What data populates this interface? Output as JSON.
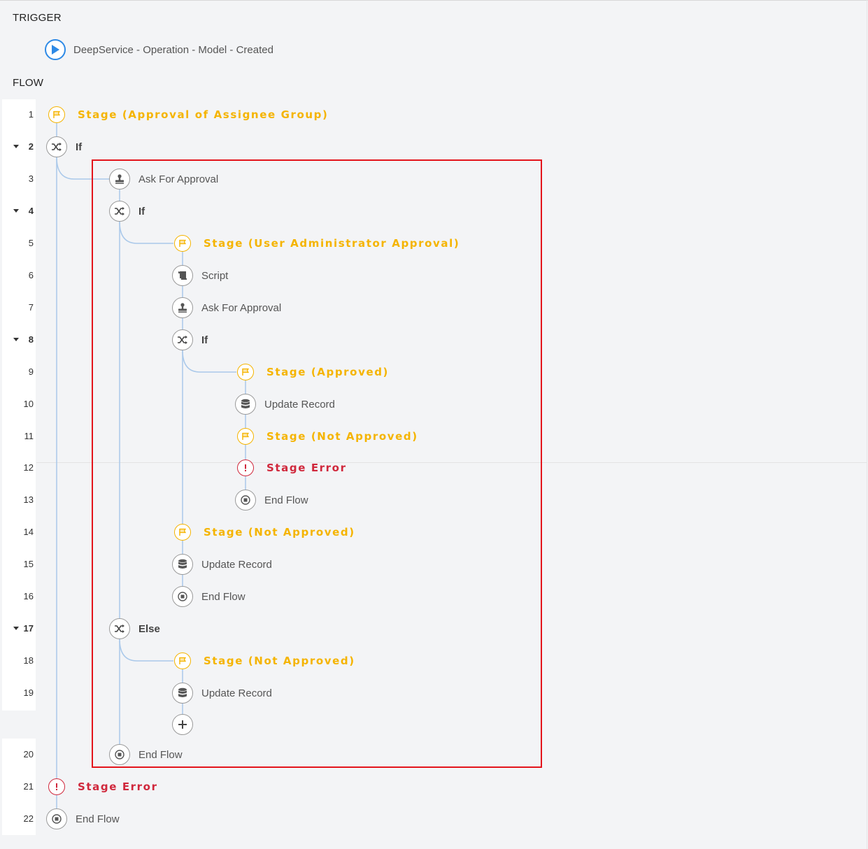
{
  "trigger": {
    "section_label": "TRIGGER",
    "name": "DeepService - Operation - Model - Created",
    "icon": "play-icon",
    "icon_color": "#2e8ae6"
  },
  "flow": {
    "section_label": "FLOW",
    "colors": {
      "stage": "#f5b400",
      "error": "#d0283c",
      "connector": "#a9c8ea"
    },
    "steps": [
      {
        "line": "1",
        "label": "Stage (Approval of Assignee Group)",
        "kind": "stage",
        "icon": "stage-flag-icon"
      },
      {
        "line": "2",
        "label": "If",
        "kind": "logic",
        "icon": "shuffle-icon",
        "collapsible": true
      },
      {
        "line": "3",
        "label": "Ask For Approval",
        "kind": "action",
        "icon": "approval-stamp-icon"
      },
      {
        "line": "4",
        "label": "If",
        "kind": "logic",
        "icon": "shuffle-icon",
        "collapsible": true
      },
      {
        "line": "5",
        "label": "Stage (User Administrator Approval)",
        "kind": "stage",
        "icon": "stage-flag-icon"
      },
      {
        "line": "6",
        "label": "Script",
        "kind": "action",
        "icon": "script-icon"
      },
      {
        "line": "7",
        "label": "Ask For Approval",
        "kind": "action",
        "icon": "approval-stamp-icon"
      },
      {
        "line": "8",
        "label": "If",
        "kind": "logic",
        "icon": "shuffle-icon",
        "collapsible": true
      },
      {
        "line": "9",
        "label": "Stage (Approved)",
        "kind": "stage",
        "icon": "stage-flag-icon"
      },
      {
        "line": "10",
        "label": "Update Record",
        "kind": "action",
        "icon": "database-icon"
      },
      {
        "line": "11",
        "label": "Stage (Not Approved)",
        "kind": "stage",
        "icon": "stage-flag-icon"
      },
      {
        "line": "12",
        "label": "Stage Error",
        "kind": "error",
        "icon": "error-icon"
      },
      {
        "line": "13",
        "label": "End Flow",
        "kind": "action",
        "icon": "stop-icon"
      },
      {
        "line": "14",
        "label": "Stage (Not Approved)",
        "kind": "stage",
        "icon": "stage-flag-icon"
      },
      {
        "line": "15",
        "label": "Update Record",
        "kind": "action",
        "icon": "database-icon"
      },
      {
        "line": "16",
        "label": "End Flow",
        "kind": "action",
        "icon": "stop-icon"
      },
      {
        "line": "17",
        "label": "Else",
        "kind": "logic",
        "icon": "shuffle-icon",
        "collapsible": true
      },
      {
        "line": "18",
        "label": "Stage (Not Approved)",
        "kind": "stage",
        "icon": "stage-flag-icon"
      },
      {
        "line": "19",
        "label": "Update Record",
        "kind": "action",
        "icon": "database-icon"
      },
      {
        "line": "",
        "label": "",
        "kind": "add",
        "icon": "add-icon"
      },
      {
        "line": "20",
        "label": "End Flow",
        "kind": "action",
        "icon": "stop-icon"
      },
      {
        "line": "21",
        "label": "Stage Error",
        "kind": "error",
        "icon": "error-icon"
      },
      {
        "line": "22",
        "label": "End Flow",
        "kind": "action",
        "icon": "stop-icon"
      }
    ]
  }
}
